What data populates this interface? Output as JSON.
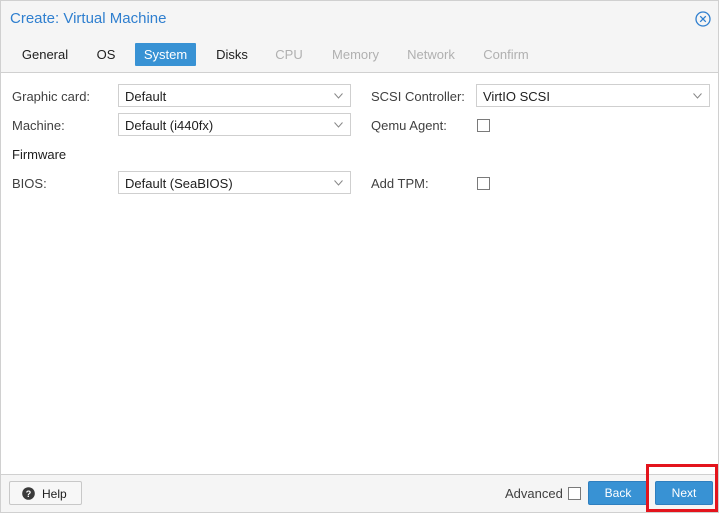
{
  "window": {
    "title": "Create: Virtual Machine"
  },
  "tabs": [
    {
      "label": "General",
      "state": "enabled"
    },
    {
      "label": "OS",
      "state": "enabled"
    },
    {
      "label": "System",
      "state": "active"
    },
    {
      "label": "Disks",
      "state": "enabled"
    },
    {
      "label": "CPU",
      "state": "disabled"
    },
    {
      "label": "Memory",
      "state": "disabled"
    },
    {
      "label": "Network",
      "state": "disabled"
    },
    {
      "label": "Confirm",
      "state": "disabled"
    }
  ],
  "form": {
    "graphic_card": {
      "label": "Graphic card:",
      "value": "Default"
    },
    "machine": {
      "label": "Machine:",
      "value": "Default (i440fx)"
    },
    "firmware_heading": "Firmware",
    "bios": {
      "label": "BIOS:",
      "value": "Default (SeaBIOS)"
    },
    "scsi_controller": {
      "label": "SCSI Controller:",
      "value": "VirtIO SCSI"
    },
    "qemu_agent": {
      "label": "Qemu Agent:",
      "checked": false
    },
    "add_tpm": {
      "label": "Add TPM:",
      "checked": false
    }
  },
  "footer": {
    "help_label": "Help",
    "advanced_label": "Advanced",
    "advanced_checked": false,
    "back_label": "Back",
    "next_label": "Next"
  },
  "colors": {
    "accent": "#3892d4",
    "title": "#2f7fcf",
    "highlight": "#e3141c"
  }
}
